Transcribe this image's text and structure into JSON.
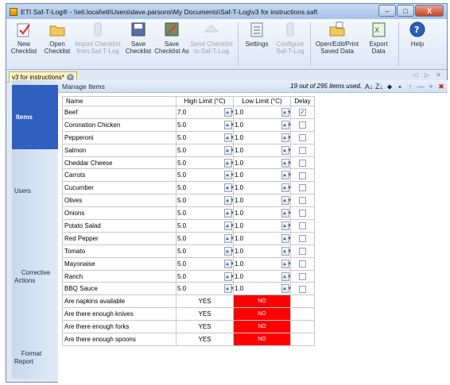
{
  "window": {
    "title": "ETI Saf-T-Log® - \\\\eti.local\\eti\\Users\\dave.parsons\\My Documents\\Saf-T-Log\\v3 for instructions.saft",
    "minimize": "–",
    "maximize": "□",
    "close": "X"
  },
  "ribbon": [
    {
      "label": "New\nChecklist",
      "icon": "new-checklist-icon",
      "enabled": true
    },
    {
      "label": "Open\nChecklist",
      "icon": "open-folder-icon",
      "enabled": true
    },
    {
      "label": "Import Checklist\nfrom Saf-T-Log",
      "icon": "import-device-icon",
      "enabled": false
    },
    {
      "label": "Save\nChecklist",
      "icon": "save-disk-icon",
      "enabled": true
    },
    {
      "label": "Save\nChecklist As",
      "icon": "save-as-icon",
      "enabled": true
    },
    {
      "label": "Send Checklist\nto Saf-T-Log",
      "icon": "send-device-icon",
      "enabled": false
    },
    {
      "label": "Settings",
      "icon": "settings-list-icon",
      "enabled": true
    },
    {
      "label": "Configure\nSaf-T-Log",
      "icon": "configure-device-icon",
      "enabled": false
    },
    {
      "label": "Open/Edit/Print\nSaved Data",
      "icon": "open-data-icon",
      "enabled": true
    },
    {
      "label": "Export\nData",
      "icon": "excel-export-icon",
      "enabled": true
    },
    {
      "label": "Help",
      "icon": "help-icon",
      "enabled": true
    }
  ],
  "doc_tab": {
    "label": "v3 for instructions*",
    "close": "×",
    "nav": "◁ ▷ ✕"
  },
  "sidebar": [
    {
      "label": "Items",
      "active": true
    },
    {
      "label": "Users",
      "active": false
    },
    {
      "label": "Corrective\nActions",
      "active": false
    },
    {
      "label": "Format\nReport",
      "active": false
    }
  ],
  "main": {
    "header": "Manage Items",
    "count": "19 out of 295 items used.",
    "tools": [
      "A↓",
      "Z↓",
      "⬥",
      "⬩",
      "↑",
      "—",
      "+",
      "✖"
    ]
  },
  "table": {
    "columns": [
      "Name",
      "High Limit (°C)",
      "Low Limit (°C)",
      "Delay"
    ],
    "numeric_rows": [
      {
        "name": "Beef",
        "high": "7.0",
        "low": "1.0",
        "delay": true
      },
      {
        "name": "Coronation Chicken",
        "high": "5.0",
        "low": "1.0",
        "delay": false
      },
      {
        "name": "Pepperoni",
        "high": "5.0",
        "low": "1.0",
        "delay": false
      },
      {
        "name": "Salmon",
        "high": "5.0",
        "low": "1.0",
        "delay": false
      },
      {
        "name": "Cheddar Cheese",
        "high": "5.0",
        "low": "1.0",
        "delay": false
      },
      {
        "name": "Carrots",
        "high": "5.0",
        "low": "1.0",
        "delay": false
      },
      {
        "name": "Cucumber",
        "high": "5.0",
        "low": "1.0",
        "delay": false
      },
      {
        "name": "Olives",
        "high": "5.0",
        "low": "1.0",
        "delay": false
      },
      {
        "name": "Onions",
        "high": "5.0",
        "low": "1.0",
        "delay": false
      },
      {
        "name": "Potato Salad",
        "high": "5.0",
        "low": "1.0",
        "delay": false
      },
      {
        "name": "Red Pepper",
        "high": "5.0",
        "low": "1.0",
        "delay": false
      },
      {
        "name": "Tomato",
        "high": "5.0",
        "low": "1.0",
        "delay": false
      },
      {
        "name": "Mayonaise",
        "high": "5.0",
        "low": "1.0",
        "delay": false
      },
      {
        "name": "Ranch",
        "high": "5.0",
        "low": "1.0",
        "delay": false
      },
      {
        "name": "BBQ Sauce",
        "high": "5.0",
        "low": "1.0",
        "delay": false
      }
    ],
    "question_rows": [
      {
        "name": "Are napkins available",
        "yes": "YES",
        "no": "NO"
      },
      {
        "name": "Are there enough knives",
        "yes": "YES",
        "no": "NO"
      },
      {
        "name": "Are there enough forks",
        "yes": "YES",
        "no": "NO"
      },
      {
        "name": "Are there enough spoons",
        "yes": "YES",
        "no": "NO"
      }
    ]
  },
  "colors": {
    "active_nav": "#2f5fbf",
    "no_cell": "#ff0000"
  }
}
